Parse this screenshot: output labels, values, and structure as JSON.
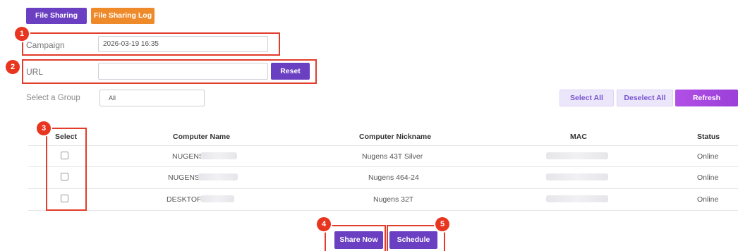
{
  "tabs": {
    "file_sharing": "File Sharing",
    "file_sharing_log": "File Sharing Log"
  },
  "campaign": {
    "label": "Campaign",
    "value": "2026-03-19 16:35"
  },
  "url": {
    "label": "URL",
    "value": "",
    "reset_label": "Reset"
  },
  "group": {
    "label": "Select a Group",
    "selected": "All",
    "select_all": "Select All",
    "deselect_all": "Deselect All",
    "refresh": "Refresh"
  },
  "table": {
    "headers": [
      "Select",
      "Computer Name",
      "Computer Nickname",
      "MAC",
      "Status"
    ],
    "rows": [
      {
        "name": "NUGENS",
        "nickname": "Nugens 43T Silver",
        "status": "Online"
      },
      {
        "name": "NUGENS",
        "nickname": "Nugens 464-24",
        "status": "Online"
      },
      {
        "name": "DESKTOP",
        "nickname": "Nugens 32T",
        "status": "Online"
      }
    ]
  },
  "actions": {
    "share_now": "Share Now",
    "schedule": "Schedule"
  },
  "annotations": [
    "1",
    "2",
    "3",
    "4",
    "5"
  ],
  "colors": {
    "primary": "#6a3fc1",
    "orange": "#ef8a2a",
    "annotation_red": "#e23c2b"
  }
}
